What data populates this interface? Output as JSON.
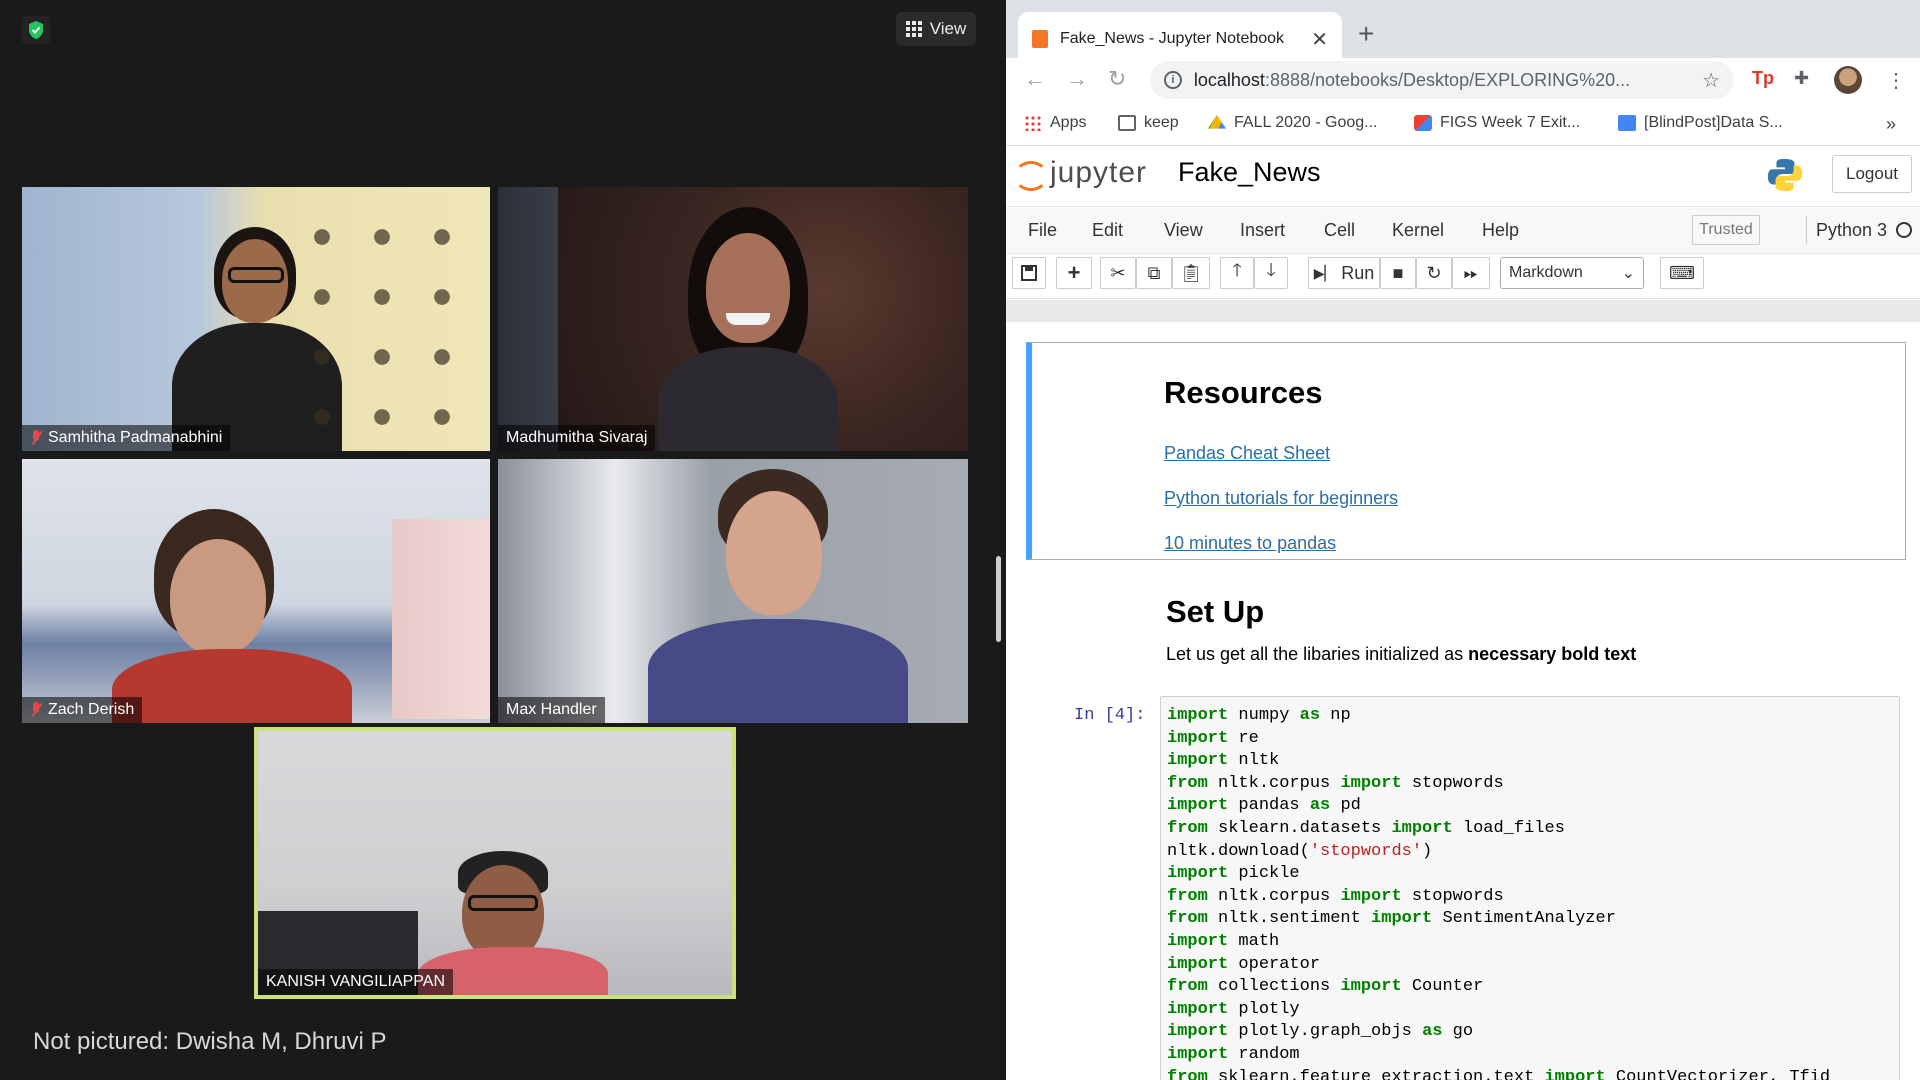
{
  "zoom": {
    "view_label": "View",
    "participants": [
      {
        "name": "Samhitha Padmanabhini",
        "muted": true
      },
      {
        "name": "Madhumitha Sivaraj",
        "muted": false
      },
      {
        "name": "Zach Derish",
        "muted": true
      },
      {
        "name": "Max Handler",
        "muted": false
      },
      {
        "name": "KANISH VANGILIAPPAN",
        "muted": false,
        "active_speaker": true
      }
    ],
    "not_pictured": "Not pictured: Dwisha M, Dhruvi P"
  },
  "browser": {
    "tab_title": "Fake_News - Jupyter Notebook",
    "new_tab": "+",
    "url_host": "localhost",
    "url_rest": ":8888/notebooks/Desktop/EXPLORING%20...",
    "bookmarks": [
      {
        "label": "Apps",
        "icon": "apps-grid-icon"
      },
      {
        "label": "keep",
        "icon": "folder-icon"
      },
      {
        "label": "FALL 2020 - Goog...",
        "icon": "google-drive-icon"
      },
      {
        "label": "FIGS Week 7 Exit...",
        "icon": "figs-icon"
      },
      {
        "label": "[BlindPost]Data S...",
        "icon": "google-docs-icon"
      }
    ],
    "bookmarks_more": "»",
    "accent_colors": {
      "jupyter_orange": "#f37626",
      "link_blue": "#296eaa",
      "cell_selected": "#42a5f5"
    }
  },
  "jupyter": {
    "logo_text": "jupyter",
    "notebook_name": "Fake_News",
    "logout_label": "Logout",
    "menus": [
      "File",
      "Edit",
      "View",
      "Insert",
      "Cell",
      "Kernel",
      "Help"
    ],
    "trusted_label": "Trusted",
    "kernel_name": "Python 3",
    "run_label": "Run",
    "cell_type": "Markdown",
    "resources_title": "Resources",
    "links": [
      "Pandas Cheat Sheet",
      "Python tutorials for beginners",
      "10 minutes to pandas"
    ],
    "setup_title": "Set Up",
    "setup_text_plain": "Let us get all the libaries initialized as ",
    "setup_text_bold": "necessary bold text",
    "code_prompt": "In [4]:"
  }
}
